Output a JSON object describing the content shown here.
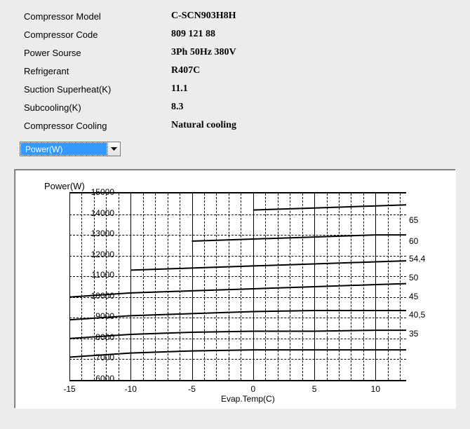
{
  "specs": {
    "rows": [
      {
        "label": "Compressor Model",
        "value": "C-SCN903H8H"
      },
      {
        "label": "Compressor Code",
        "value": "809 121 88"
      },
      {
        "label": "Power Sourse",
        "value": "3Ph  50Hz  380V"
      },
      {
        "label": "Refrigerant",
        "value": "R407C"
      },
      {
        "label": "Suction Superheat(K)",
        "value": "11.1"
      },
      {
        "label": "Subcooling(K)",
        "value": "8.3"
      },
      {
        "label": "Compressor Cooling",
        "value": "Natural cooling"
      }
    ]
  },
  "dropdown": {
    "selected": "Power(W)"
  },
  "chart": {
    "title": "Power(W)",
    "xlabel": "Evap.Temp(C)"
  },
  "chart_data": {
    "type": "line",
    "title": "Power(W)",
    "xlabel": "Evap.Temp(C)",
    "ylabel": "",
    "xlim": [
      -15,
      12.5
    ],
    "ylim": [
      6000,
      15000
    ],
    "xticks": [
      -15,
      -10,
      -5,
      0,
      5,
      10
    ],
    "yticks": [
      6000,
      7000,
      8000,
      9000,
      10000,
      11000,
      12000,
      13000,
      14000,
      15000
    ],
    "x": [
      -15,
      -10,
      -5,
      0,
      5,
      10,
      12.5
    ],
    "series": [
      {
        "name": "65",
        "values": [
          null,
          null,
          null,
          14200,
          14300,
          14400,
          14450
        ]
      },
      {
        "name": "60",
        "values": [
          null,
          null,
          12700,
          12800,
          12900,
          13000,
          13000
        ]
      },
      {
        "name": "54,4",
        "values": [
          null,
          11300,
          11400,
          11500,
          11600,
          11700,
          11750
        ]
      },
      {
        "name": "50",
        "values": [
          10000,
          10200,
          10300,
          10400,
          10500,
          10600,
          10650
        ]
      },
      {
        "name": "45",
        "values": [
          8900,
          9100,
          9200,
          9300,
          9350,
          9350,
          9350
        ]
      },
      {
        "name": "40,5",
        "values": [
          8000,
          8200,
          8300,
          8350,
          8350,
          8400,
          8400
        ]
      },
      {
        "name": "35",
        "values": [
          7100,
          7300,
          7400,
          7450,
          7450,
          7450,
          7450
        ]
      }
    ],
    "series_label_ypos": [
      65,
      95,
      120,
      147,
      174,
      200,
      227
    ]
  }
}
